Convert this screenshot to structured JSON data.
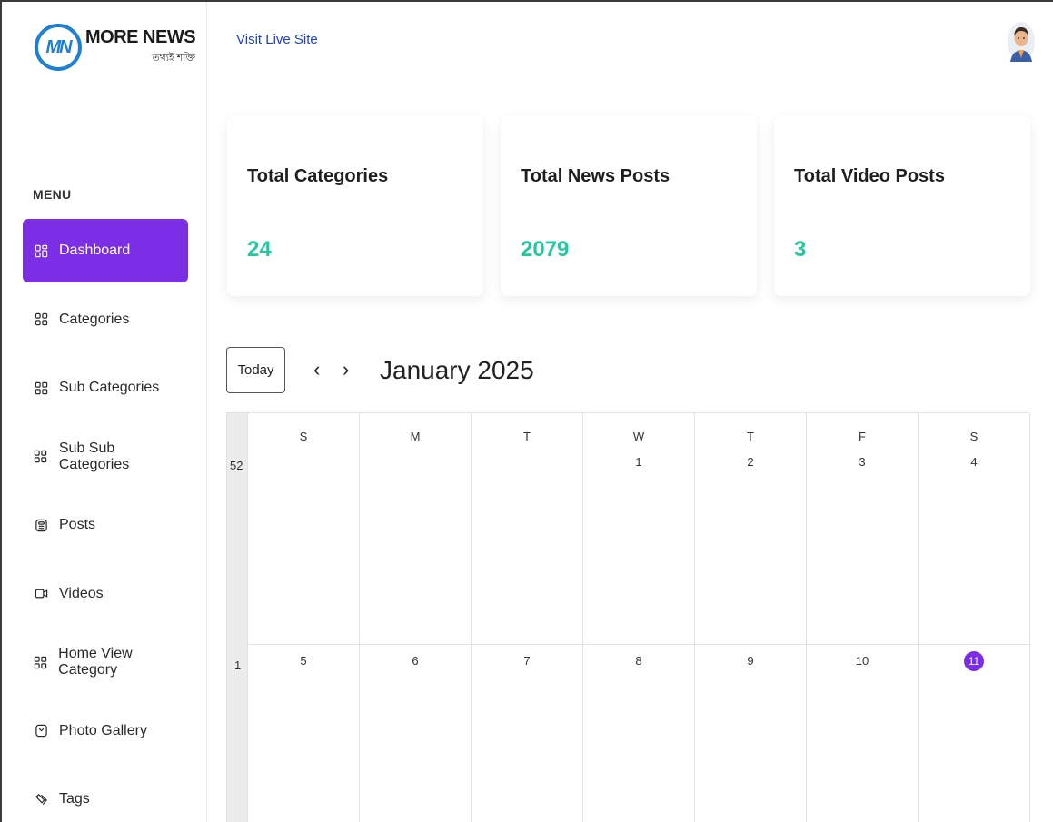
{
  "brand": {
    "logo_mark": "MN",
    "title": "MORE NEWS",
    "tagline": "তথ্যই শক্তি"
  },
  "sidebar": {
    "menu_label": "MENU",
    "items": [
      {
        "label": "Dashboard",
        "icon": "dashboard-icon",
        "active": true
      },
      {
        "label": "Categories",
        "icon": "grid-icon",
        "active": false
      },
      {
        "label": "Sub Categories",
        "icon": "grid-icon",
        "active": false
      },
      {
        "label": "Sub Sub Categories",
        "icon": "grid-icon",
        "active": false
      },
      {
        "label": "Posts",
        "icon": "post-icon",
        "active": false
      },
      {
        "label": "Videos",
        "icon": "video-icon",
        "active": false
      },
      {
        "label": "Home View Category",
        "icon": "grid-icon",
        "active": false
      },
      {
        "label": "Photo Gallery",
        "icon": "gallery-icon",
        "active": false
      },
      {
        "label": "Tags",
        "icon": "tag-icon",
        "active": false
      }
    ]
  },
  "header": {
    "visit_link": "Visit Live Site",
    "avatar_icon": "user-avatar-icon"
  },
  "stats": [
    {
      "title": "Total Categories",
      "value": "24"
    },
    {
      "title": "Total News Posts",
      "value": "2079"
    },
    {
      "title": "Total Video Posts",
      "value": "3"
    }
  ],
  "calendar": {
    "today_label": "Today",
    "prev_icon": "chevron-left-icon",
    "next_icon": "chevron-right-icon",
    "month_title": "January 2025",
    "weekdays": [
      "S",
      "M",
      "T",
      "W",
      "T",
      "F",
      "S"
    ],
    "weeks": [
      {
        "number": "52",
        "days": [
          "",
          "",
          "",
          "1",
          "2",
          "3",
          "4"
        ]
      },
      {
        "number": "1",
        "days": [
          "5",
          "6",
          "7",
          "8",
          "9",
          "10",
          "11"
        ]
      }
    ],
    "today": "11"
  },
  "colors": {
    "accent": "#7b2ee6",
    "stat_value": "#21c9a0",
    "link": "#1b3fd8",
    "logo_blue": "#1f7fd1"
  }
}
